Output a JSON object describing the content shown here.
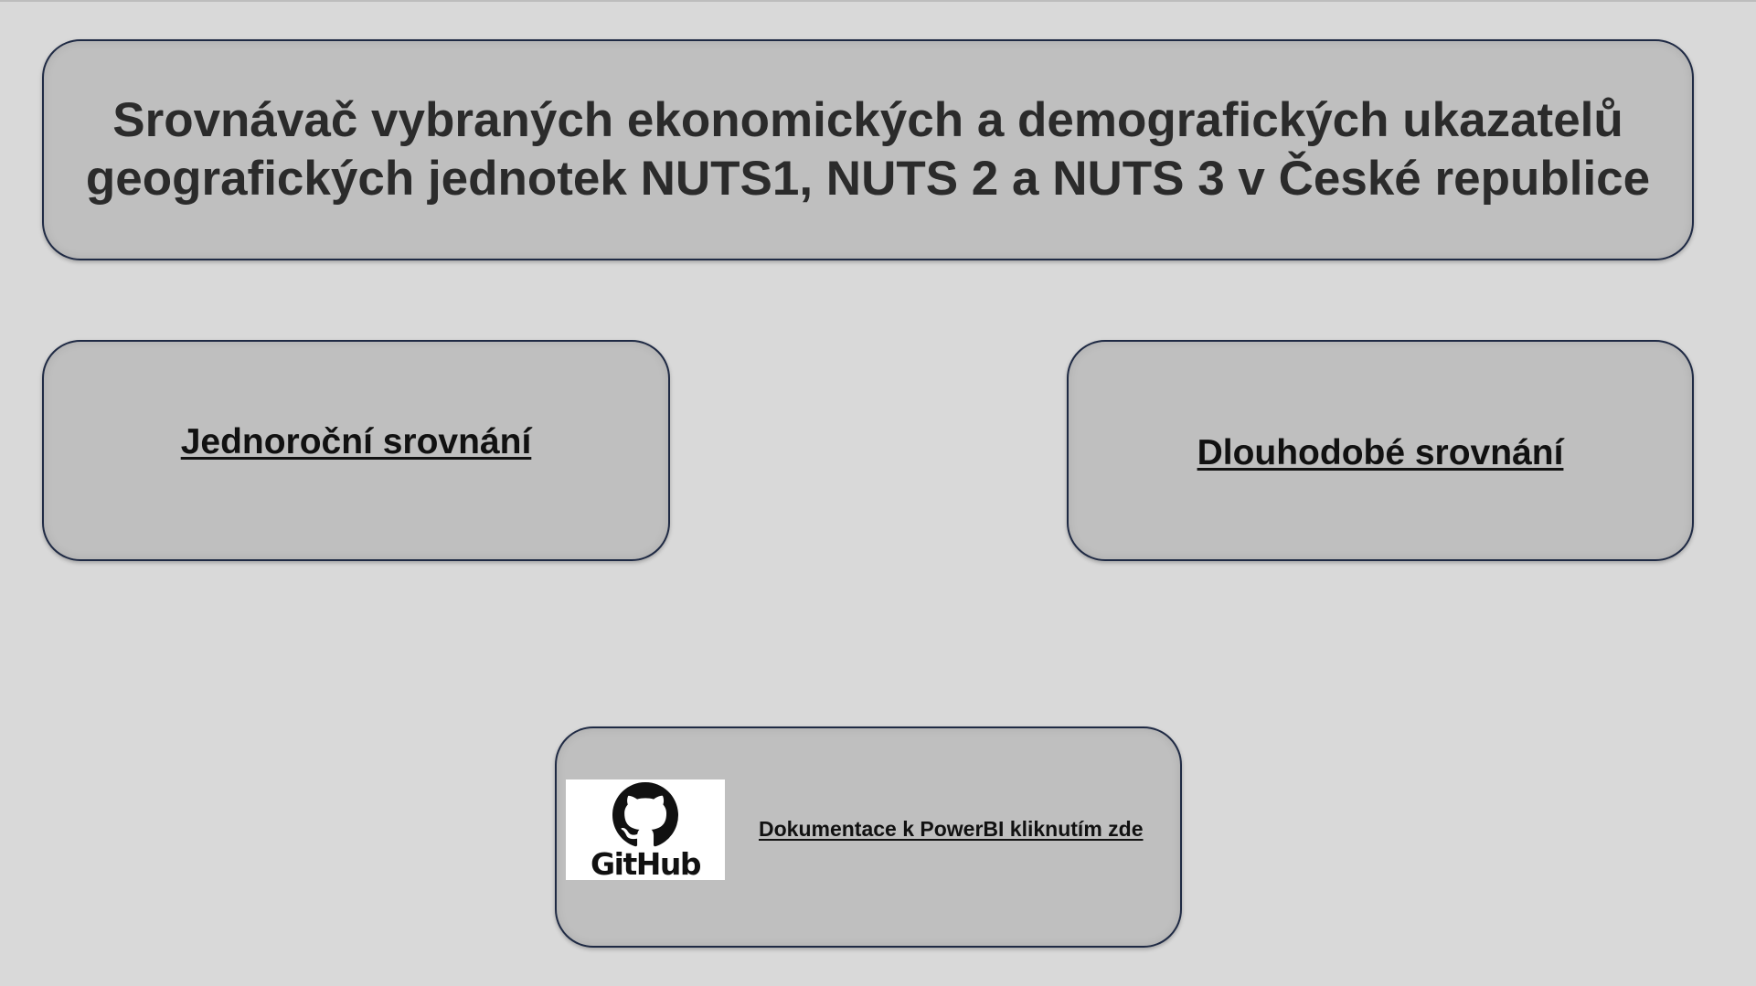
{
  "header": {
    "title": "Srovnávač vybraných ekonomických a demografických ukazatelů geografických jednotek NUTS1, NUTS 2 a NUTS 3 v České republice"
  },
  "navigation": {
    "one_year_label": "Jednoroční srovnání",
    "long_term_label": "Dlouhodobé srovnání"
  },
  "documentation": {
    "logo_icon": "github-logo-icon",
    "logo_text": "GitHub",
    "link_label": "Dokumentace k PowerBI kliknutím zde"
  },
  "colors": {
    "background": "#d9d9d9",
    "card_fill": "#bfbfbf",
    "card_border": "#1f2a44",
    "text": "#2b2b2b"
  }
}
